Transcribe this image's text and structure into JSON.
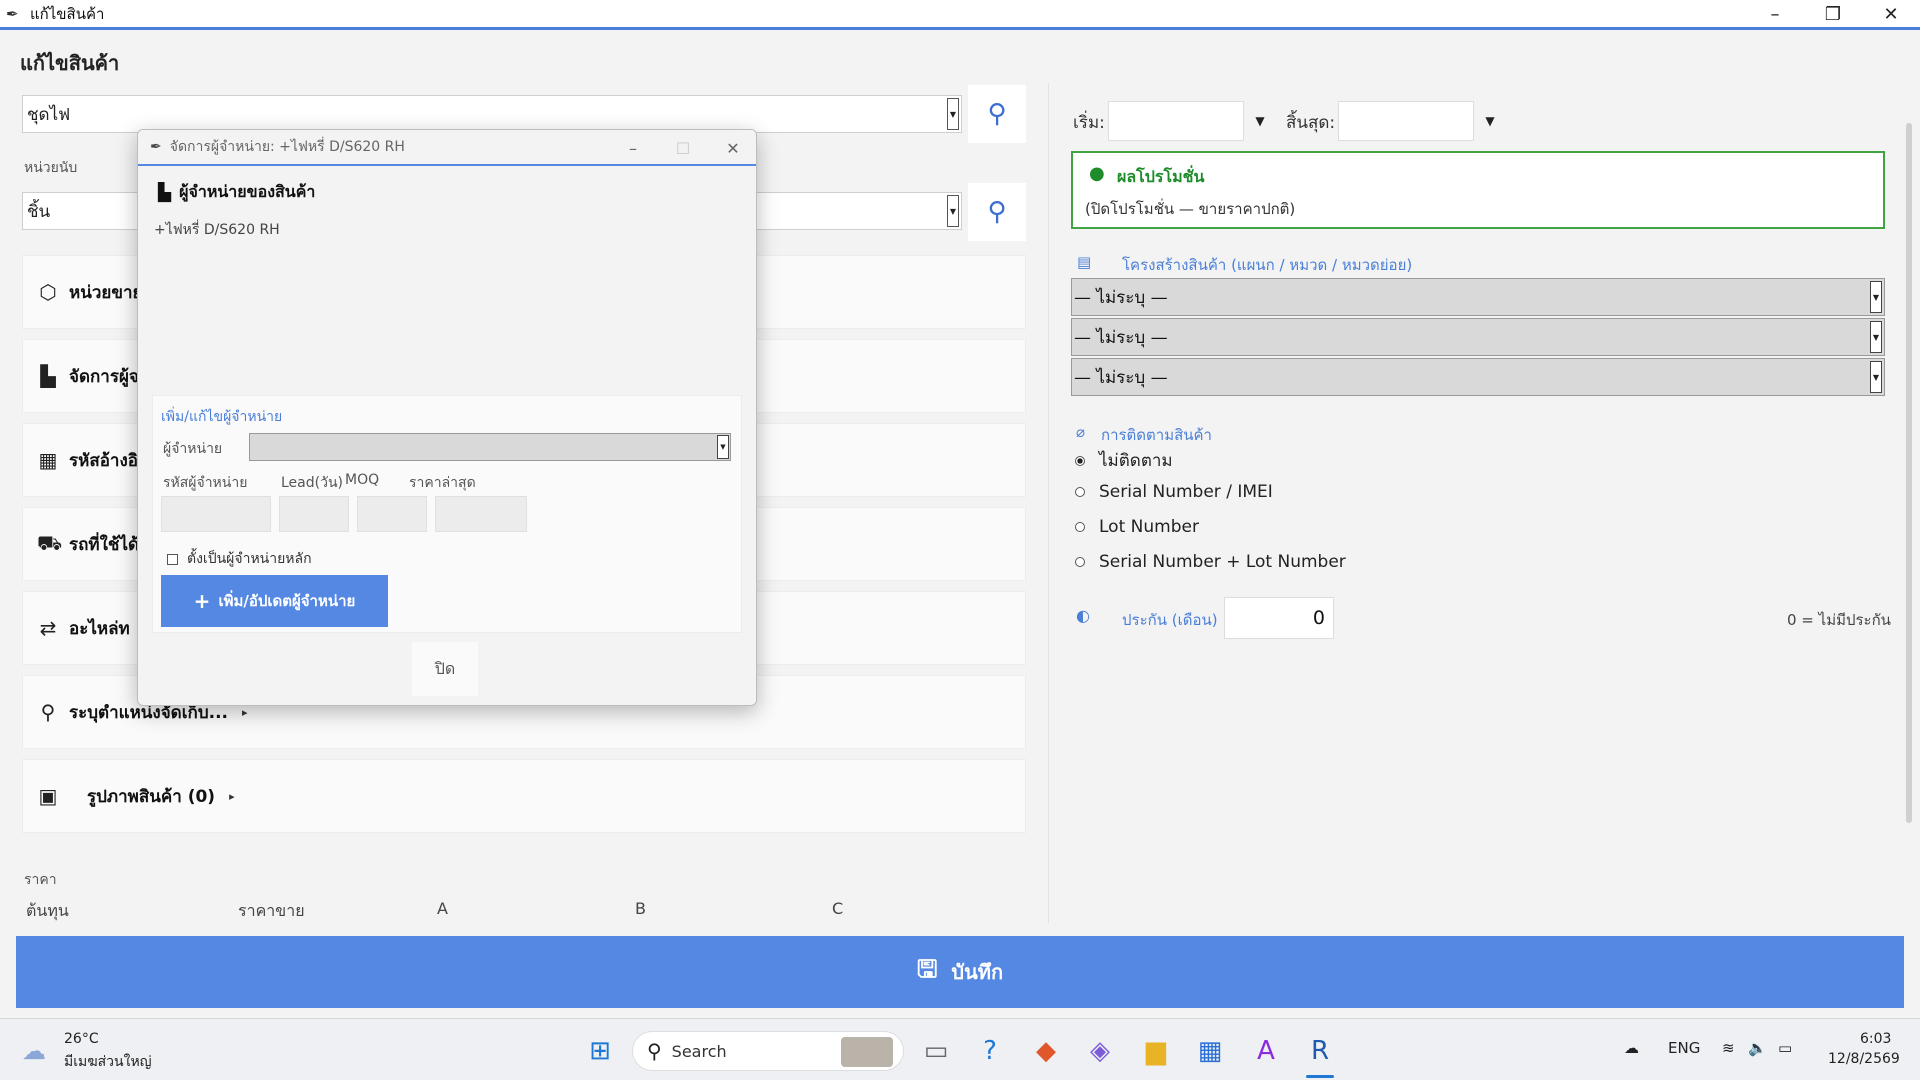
{
  "window": {
    "title": "แก้ไขสินค้า",
    "controls": [
      "–",
      "❐",
      "✕"
    ]
  },
  "page": {
    "title": "แก้ไขสินค้า",
    "product_name": "ชุดไฟ",
    "unit_label": "หน่วยนับ",
    "unit_value": "ชิ้น"
  },
  "sections": [
    {
      "label": "หน่วยขาย",
      "icon": "box-icon"
    },
    {
      "label": "จัดการผู้จ",
      "icon": "factory-icon"
    },
    {
      "label": "รหัสอ้างอิ",
      "icon": "keypad-icon"
    },
    {
      "label": "รถที่ใช้ได้",
      "icon": "car-icon"
    },
    {
      "label": "อะไหล่ท",
      "icon": "swap-icon"
    },
    {
      "label": "ระบุตำแหน่งจัดเก็บ...",
      "icon": "pin-icon",
      "expand": "▸"
    },
    {
      "label": "รูปภาพสินค้า (0)",
      "icon": "image-icon",
      "expand": "▸"
    }
  ],
  "price": {
    "label": "ราคา",
    "columns": [
      "ต้นทุน",
      "ราคาขาย",
      "A",
      "B",
      "C"
    ]
  },
  "promotion_period": {
    "start_label": "เริ่ม:",
    "end_label": "สิ้นสุด:",
    "start_value": "",
    "end_value": ""
  },
  "promotion_result": {
    "title": "ผลโปรโมชั่น",
    "desc": "(ปิดโปรโมชั่น — ขายราคาปกติ)"
  },
  "structure": {
    "title": "โครงสร้างสินค้า (แผนก / หมวด / หมวดย่อย)",
    "levels": [
      "— ไม่ระบุ —",
      "— ไม่ระบุ —",
      "— ไม่ระบุ —"
    ]
  },
  "tracking": {
    "title": "การติดตามสินค้า",
    "options": [
      "ไม่ติดตาม",
      "Serial Number / IMEI",
      "Lot Number",
      "Serial Number + Lot Number"
    ],
    "selected": 0
  },
  "warranty": {
    "label": "ประกัน (เดือน)",
    "value": "0",
    "note": "0 = ไม่มีประกัน"
  },
  "save_button": "บันทึก",
  "dialog": {
    "title": "จัดการผู้จำหน่าย: +ไฟหรี่ D/S620 RH",
    "heading": "ผู้จำหน่ายของสินค้า",
    "product": "+ไฟหรี่ D/S620 RH",
    "panel_title": "เพิ่ม/แก้ไขผู้จำหน่าย",
    "supplier_label": "ผู้จำหน่าย",
    "supplier_value": "",
    "col_code": "รหัสผู้จำหน่าย",
    "col_lead": "Lead(วัน)",
    "col_moq": "MOQ",
    "col_price": "ราคาล่าสุด",
    "primary_check": "ตั้งเป็นผู้จำหน่ายหลัก",
    "add_button": "เพิ่ม/อัปเดตผู้จำหน่าย",
    "close_button": "ปิด"
  },
  "taskbar": {
    "temp": "26°C",
    "weather": "มีเมฆส่วนใหญ่",
    "search": "Search",
    "lang": "ENG",
    "time": "6:03",
    "date": "12/8/2569"
  },
  "colors": {
    "accent": "#5588e3",
    "promo_green": "#41a341"
  }
}
